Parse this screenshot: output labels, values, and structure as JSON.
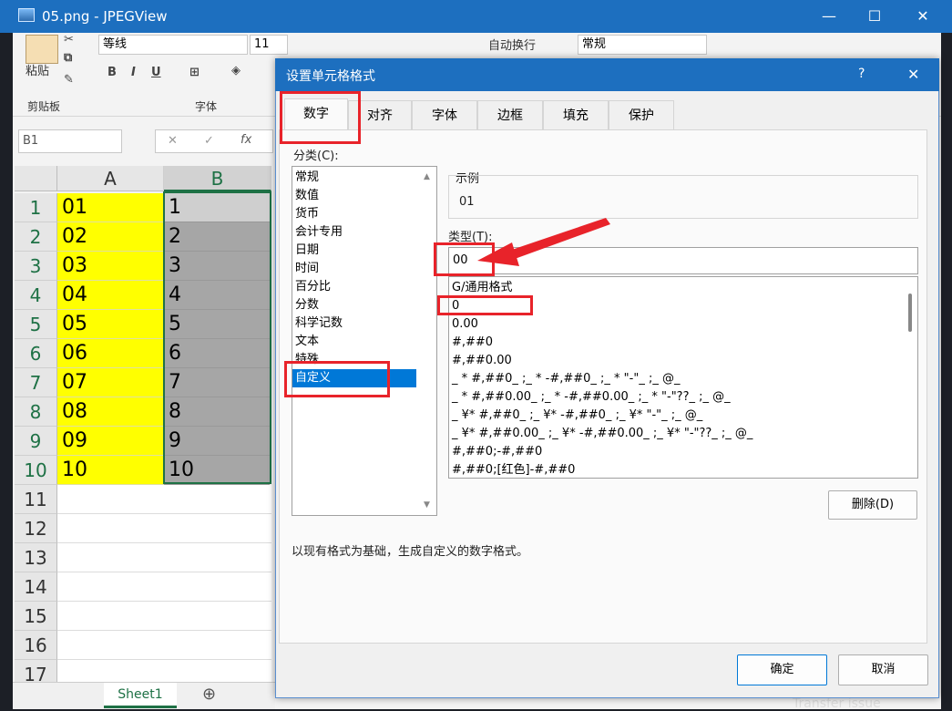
{
  "viewer": {
    "title": "05.png - JPEGView",
    "min": "—",
    "max": "☐",
    "close": "✕"
  },
  "ribbon": {
    "paste_label": "粘贴",
    "clipboard_group": "剪贴板",
    "font_group": "字体",
    "font_name": "等线",
    "font_size": "11",
    "wrap_text": "自动换行",
    "number_format": "常规",
    "bold": "B",
    "italic": "I",
    "underline": "U"
  },
  "formula": {
    "name_box": "B1",
    "cancel": "✕",
    "enter": "✓",
    "fx": "fx"
  },
  "grid": {
    "col_a": "A",
    "col_b": "B",
    "rows": [
      {
        "n": "1",
        "a": "01",
        "b": "1"
      },
      {
        "n": "2",
        "a": "02",
        "b": "2"
      },
      {
        "n": "3",
        "a": "03",
        "b": "3"
      },
      {
        "n": "4",
        "a": "04",
        "b": "4"
      },
      {
        "n": "5",
        "a": "05",
        "b": "5"
      },
      {
        "n": "6",
        "a": "06",
        "b": "6"
      },
      {
        "n": "7",
        "a": "07",
        "b": "7"
      },
      {
        "n": "8",
        "a": "08",
        "b": "8"
      },
      {
        "n": "9",
        "a": "09",
        "b": "9"
      },
      {
        "n": "10",
        "a": "10",
        "b": "10"
      }
    ],
    "empty_rows": [
      "11",
      "12",
      "13",
      "14",
      "15",
      "16",
      "17"
    ],
    "sheet_tab": "Sheet1",
    "add_sheet": "⊕"
  },
  "dialog": {
    "title": "设置单元格格式",
    "help": "?",
    "close": "✕",
    "tabs": [
      "数字",
      "对齐",
      "字体",
      "边框",
      "填充",
      "保护"
    ],
    "category_label": "分类(C):",
    "categories": [
      "常规",
      "数值",
      "货币",
      "会计专用",
      "日期",
      "时间",
      "百分比",
      "分数",
      "科学记数",
      "文本",
      "特殊",
      "自定义"
    ],
    "sample_label": "示例",
    "sample_value": "01",
    "type_label": "类型(T):",
    "type_value": "00",
    "formats": [
      "G/通用格式",
      "0",
      "0.00",
      "#,##0",
      "#,##0.00",
      "_ * #,##0_ ;_ * -#,##0_ ;_ * \"-\"_ ;_ @_",
      "_ * #,##0.00_ ;_ * -#,##0.00_ ;_ * \"-\"??_ ;_ @_",
      "_ ¥* #,##0_ ;_ ¥* -#,##0_ ;_ ¥* \"-\"_ ;_ @_",
      "_ ¥* #,##0.00_ ;_ ¥* -#,##0.00_ ;_ ¥* \"-\"??_ ;_ @_",
      "#,##0;-#,##0",
      "#,##0;[红色]-#,##0"
    ],
    "delete_button": "删除(D)",
    "description": "以现有格式为基础，生成自定义的数字格式。",
    "ok_button": "确定",
    "cancel_button": "取消"
  },
  "background_text": {
    "transfer": "Transfer issue"
  },
  "colors": {
    "accent": "#1d6fbf",
    "highlight": "#e8232a",
    "selection": "#0078d7",
    "fill_yellow": "#ffff00",
    "fill_gray": "#a6a6a6"
  }
}
